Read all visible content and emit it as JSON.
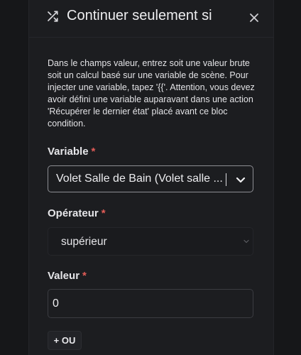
{
  "dialog": {
    "title": "Continuer seulement si",
    "description": "Dans le champs valeur, entrez soit une valeur brute soit un calcul basé sur une variable de scène. Pour injecter une variable, tapez '{{'. Attention, vous devez avoir défini une variable auparavant dans une action 'Récupérer le dernier état' placé avant ce bloc condition."
  },
  "form": {
    "variable": {
      "label": "Variable",
      "required_mark": "*",
      "selected": "Volet Salle de Bain (Volet salle ..."
    },
    "operator": {
      "label": "Opérateur",
      "required_mark": "*",
      "selected": "supérieur"
    },
    "value": {
      "label": "Valeur",
      "required_mark": "*",
      "current": "0"
    },
    "or_button": "+ OU"
  },
  "icons": {
    "header": "shuffle-icon",
    "close": "close-icon",
    "variable_dropdown": "chevron-down-icon",
    "operator_dropdown": "chevron-down-icon"
  },
  "colors": {
    "background": "#1c1d20",
    "required": "#e25c57",
    "text": "#e7e7ea"
  }
}
